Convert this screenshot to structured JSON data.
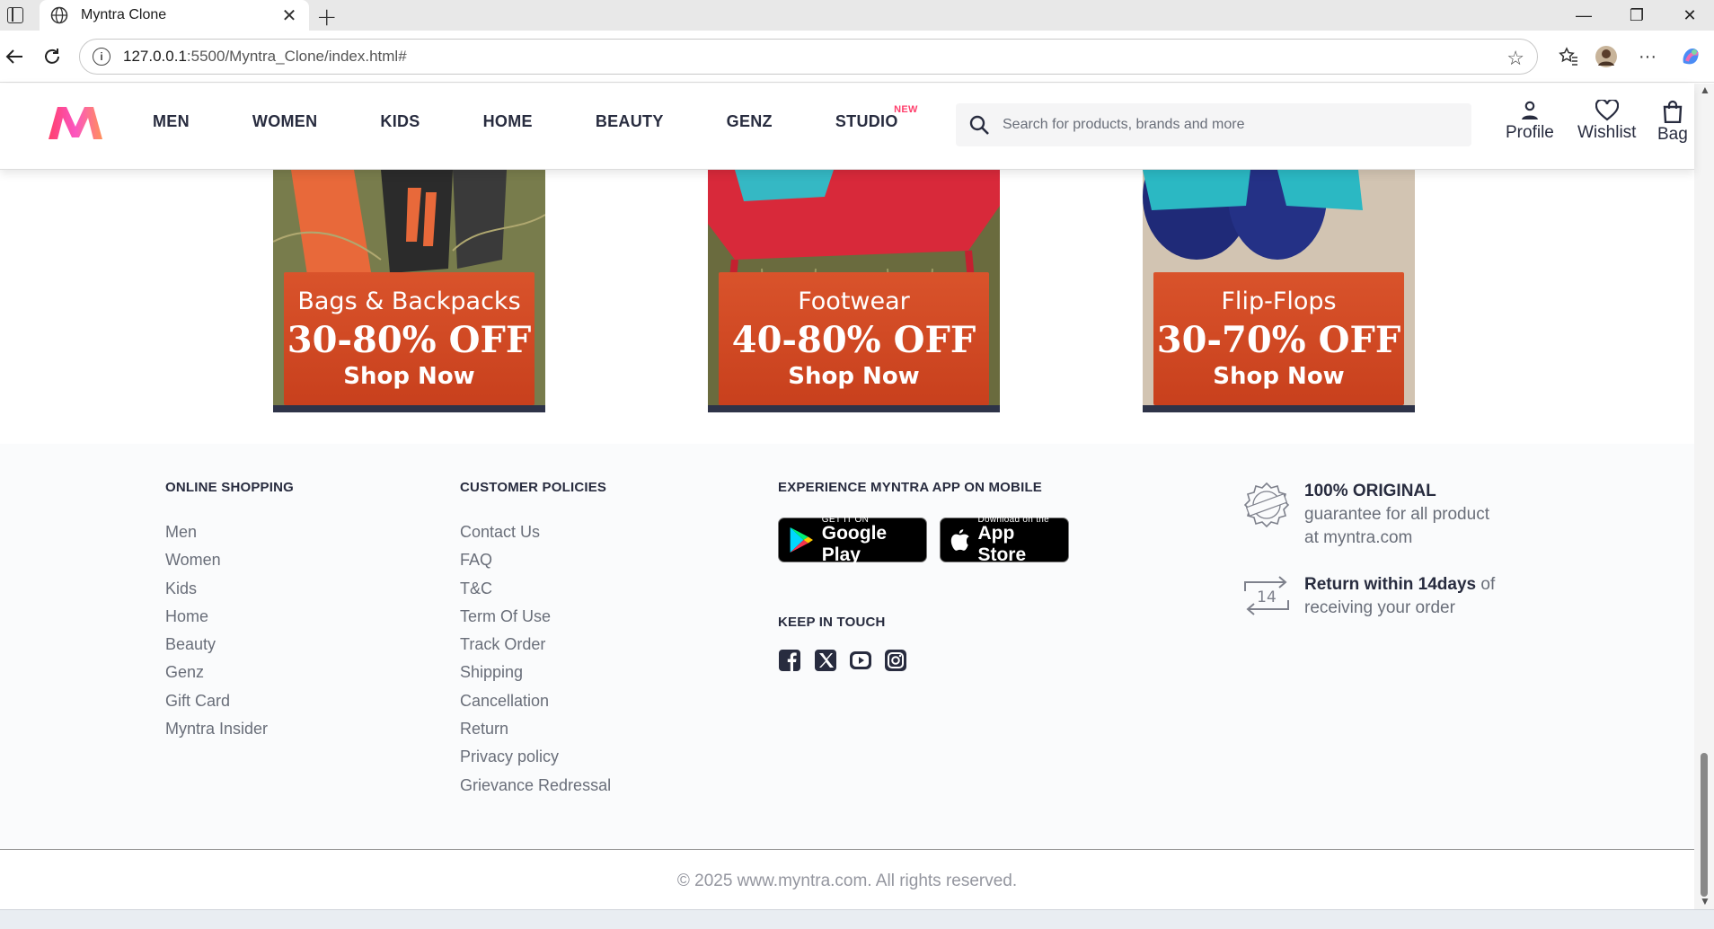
{
  "browser": {
    "tab_title": "Myntra Clone",
    "url_host": "127.0.0.1",
    "url_rest": ":5500/Myntra_Clone/index.html#"
  },
  "header": {
    "menu": [
      {
        "label": "MEN"
      },
      {
        "label": "WOMEN"
      },
      {
        "label": "KIDS"
      },
      {
        "label": "HOME"
      },
      {
        "label": "BEAUTY"
      },
      {
        "label": "GENZ"
      },
      {
        "label": "STUDIO",
        "badge": "NEW"
      }
    ],
    "search_placeholder": "Search for products, brands and more",
    "actions": {
      "profile": "Profile",
      "wishlist": "Wishlist",
      "bag": "Bag"
    },
    "brand_color": "#ff3f6c"
  },
  "banners": [
    {
      "title": "Bags & Backpacks",
      "offer": "30-80% OFF",
      "cta": "Shop Now"
    },
    {
      "title": "Footwear",
      "offer": "40-80% OFF",
      "cta": "Shop Now"
    },
    {
      "title": "Flip-Flops",
      "offer": "30-70% OFF",
      "cta": "Shop Now"
    }
  ],
  "footer": {
    "online_shopping": {
      "heading": "ONLINE SHOPPING",
      "links": [
        "Men",
        "Women",
        "Kids",
        "Home",
        "Beauty",
        "Genz",
        "Gift Card",
        "Myntra Insider"
      ]
    },
    "customer_policies": {
      "heading": "CUSTOMER POLICIES",
      "links": [
        "Contact Us",
        "FAQ",
        "T&C",
        "Term Of Use",
        "Track Order",
        "Shipping",
        "Cancellation",
        "Return",
        "Privacy policy",
        "Grievance Redressal"
      ]
    },
    "app": {
      "heading": "EXPERIENCE MYNTRA APP ON MOBILE",
      "google_small": "GET IT ON",
      "google_big": "Google Play",
      "apple_small": "Download on the",
      "apple_big": "App Store"
    },
    "keep_in_touch": {
      "heading": "KEEP IN TOUCH",
      "icons": [
        "facebook-icon",
        "x-icon",
        "youtube-icon",
        "instagram-icon"
      ]
    },
    "original": {
      "bold": "100% ORIGINAL",
      "line2": "guarantee for all product",
      "line3": "at myntra.com",
      "badge": "ORIGINAL"
    },
    "return": {
      "bold": "Return within 14days",
      "rest": "of",
      "line2": "receiving your order",
      "days": "14"
    },
    "copyright": "© 2025 www.myntra.com. All rights reserved."
  }
}
